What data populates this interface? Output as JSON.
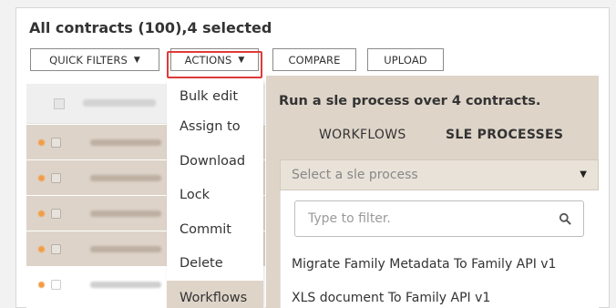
{
  "header": {
    "title": "All contracts (100),4 selected"
  },
  "toolbar": {
    "quick_filters": "QUICK FILTERS",
    "actions": "ACTIONS",
    "compare": "COMPARE",
    "upload": "UPLOAD"
  },
  "table": {
    "column_header": "FILE NAME",
    "rows": [
      "sle_sample",
      "sle_sample",
      "sle_sample",
      "sle_sample",
      "sle_sample"
    ]
  },
  "actions_menu": {
    "items": [
      "Bulk edit",
      "Assign to",
      "Download",
      "Lock",
      "Commit",
      "Delete",
      "Workflows"
    ],
    "highlighted": "Workflows"
  },
  "sle_panel": {
    "title": "Run a sle process over 4 contracts.",
    "tabs": [
      {
        "label": "WORKFLOWS",
        "active": false
      },
      {
        "label": "SLE PROCESSES",
        "active": true
      }
    ],
    "select_placeholder": "Select a sle process",
    "filter_placeholder": "Type to filter.",
    "options": [
      "Migrate Family Metadata To Family API v1",
      "XLS document To Family API v1"
    ]
  },
  "colors": {
    "highlight_outline": "#e03a3a",
    "row_selected": "#ddd3c8",
    "status_dot": "#f39c45",
    "panel_bg": "#ded4c8"
  },
  "icons": [
    "chevron-down-icon",
    "search-icon",
    "checkbox-icon",
    "status-dot-icon"
  ]
}
